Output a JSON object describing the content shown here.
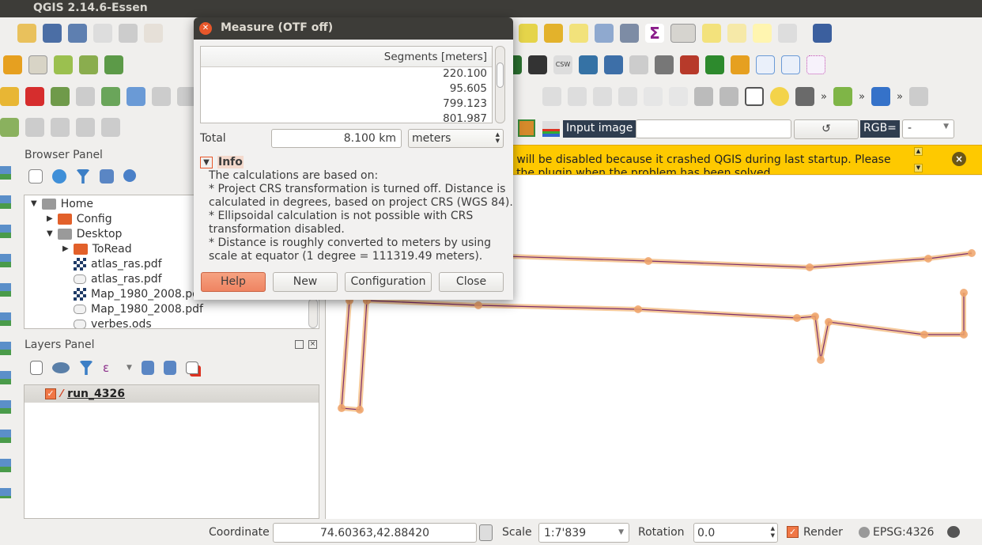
{
  "window": {
    "title": "QGIS 2.14.6-Essen"
  },
  "toolbar": {
    "input_image_label": "Input image",
    "input_image_value": "",
    "rgb_label": "RGB=",
    "rgb_value": "-",
    "refresh_icon": "refresh-icon",
    "overflow": "»"
  },
  "message_bar": {
    "line1": "n will be disabled because it crashed QGIS during last startup. Please",
    "line2": "e the plugin when the problem has been solved",
    "bg_color": "#fec900"
  },
  "browser_panel": {
    "title": "Browser Panel",
    "items": [
      {
        "label": "Home",
        "kind": "folder-gray",
        "expanded": true
      },
      {
        "label": "Config",
        "kind": "folder-orange",
        "expanded": false
      },
      {
        "label": "Desktop",
        "kind": "folder-gray",
        "expanded": true
      },
      {
        "label": "ToRead",
        "kind": "folder-orange",
        "expanded": false
      },
      {
        "label": "atlas_ras.pdf",
        "kind": "raster"
      },
      {
        "label": "atlas_ras.pdf",
        "kind": "vector"
      },
      {
        "label": "Map_1980_2008.pdf",
        "kind": "raster"
      },
      {
        "label": "Map_1980_2008.pdf",
        "kind": "vector"
      },
      {
        "label": "verbes.ods",
        "kind": "vector"
      }
    ]
  },
  "layers_panel": {
    "title": "Layers Panel",
    "layers": [
      {
        "name": "run_4326",
        "checked": true
      }
    ]
  },
  "measure_dialog": {
    "title": "Measure (OTF off)",
    "segments_header": "Segments [meters]",
    "segments": [
      "220.100",
      "95.605",
      "799.123",
      "801.987"
    ],
    "total_label": "Total",
    "total_value": "8.100 km",
    "unit": "meters",
    "info_label": "Info",
    "info_lines": [
      "The calculations are based on:",
      "* Project CRS transformation is turned off. Distance is",
      "calculated in degrees, based on project CRS (WGS 84).",
      "* Ellipsoidal calculation is not possible with CRS",
      "transformation disabled.",
      "* Distance is roughly converted to meters by using",
      "scale at equator (1 degree = 111319.49 meters)."
    ],
    "buttons": {
      "help": "Help",
      "new": "New",
      "configuration": "Configuration",
      "close": "Close"
    }
  },
  "status_bar": {
    "coordinate_label": "Coordinate",
    "coordinate": "74.60363,42.88420",
    "scale_label": "Scale",
    "scale": "1:7'839",
    "rotation_label": "Rotation",
    "rotation": "0.0",
    "render_label": "Render",
    "render_checked": true,
    "crs": "EPSG:4326"
  },
  "colors": {
    "accent": "#f0825c",
    "line": "#7b2d6b",
    "buffer": "#f5c99b"
  }
}
